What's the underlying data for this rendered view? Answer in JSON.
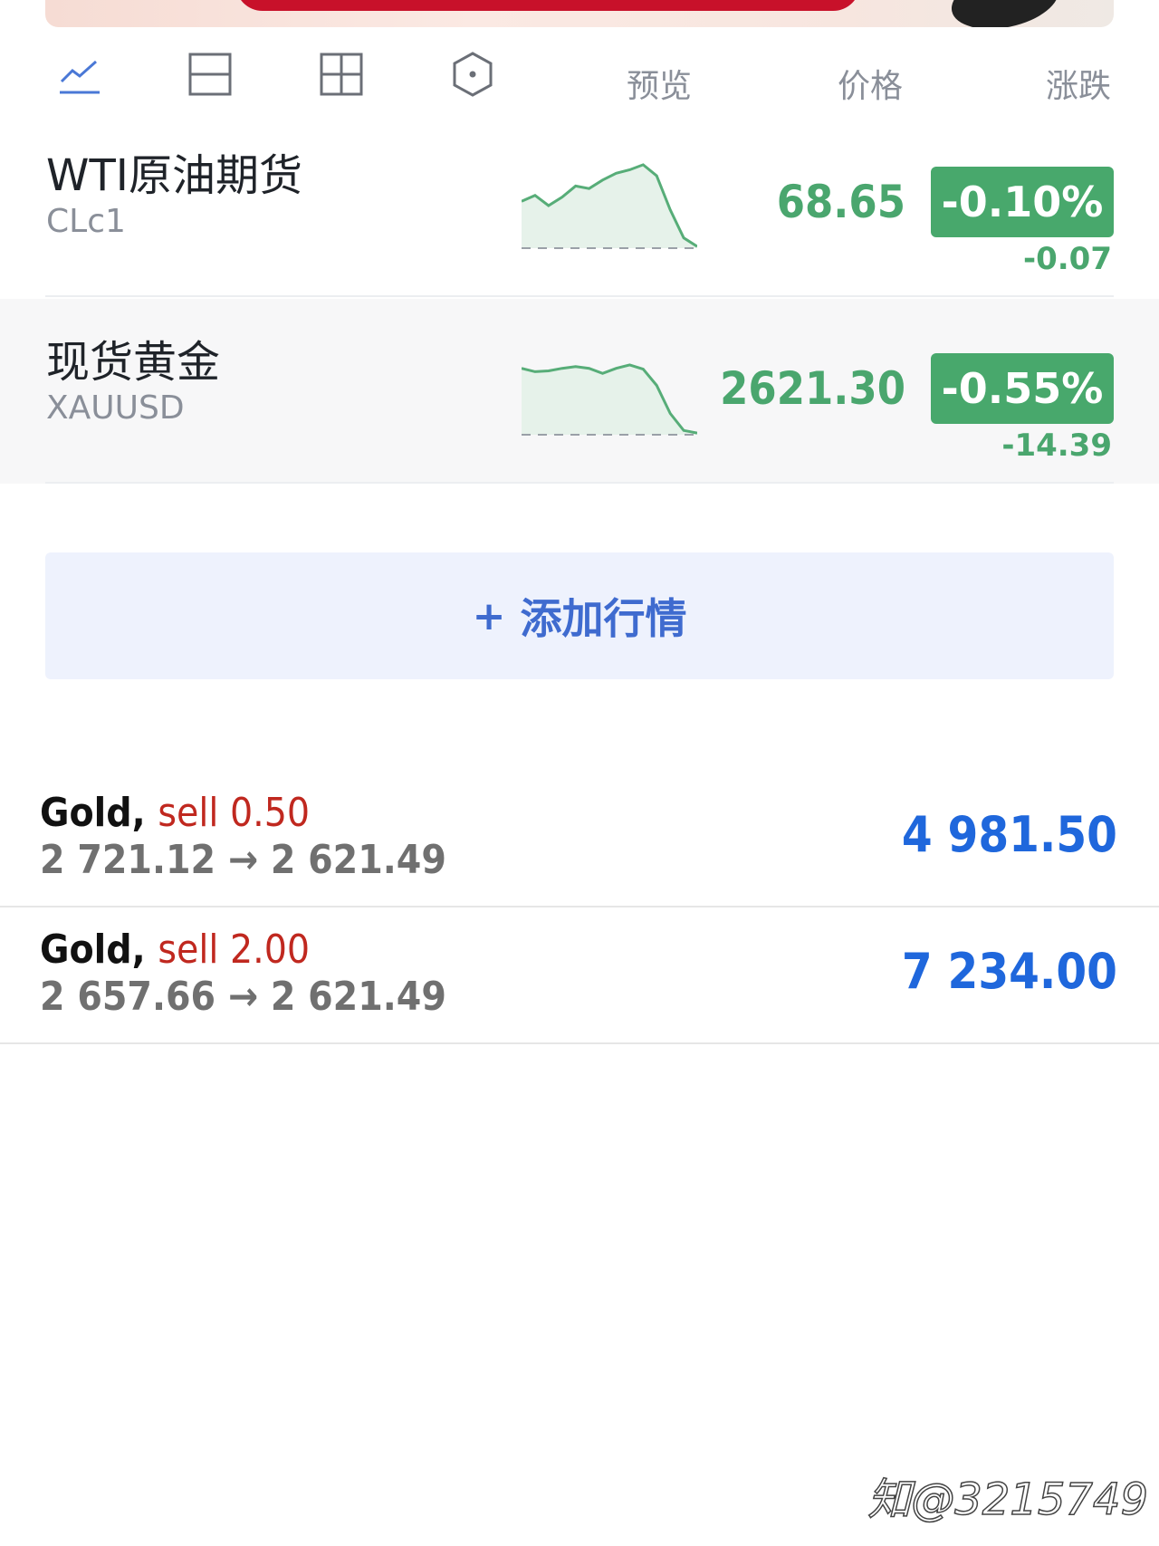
{
  "toolbar": {
    "col_preview": "预览",
    "col_price": "价格",
    "col_change": "涨跌"
  },
  "quotes": [
    {
      "name": "WTI原油期货",
      "code": "CLc1",
      "price": "68.65",
      "percent": "-0.10%",
      "change": "-0.07",
      "spark": [
        0.55,
        0.62,
        0.5,
        0.6,
        0.73,
        0.7,
        0.8,
        0.88,
        0.92,
        0.98,
        0.85,
        0.45,
        0.12,
        0.02
      ]
    },
    {
      "name": "现货黄金",
      "code": "XAUUSD",
      "price": "2621.30",
      "percent": "-0.55%",
      "change": "-14.39",
      "spark": [
        0.78,
        0.74,
        0.75,
        0.78,
        0.8,
        0.78,
        0.72,
        0.78,
        0.82,
        0.77,
        0.58,
        0.25,
        0.05,
        0.02
      ]
    }
  ],
  "add_button": {
    "plus": "+",
    "label": "添加行情"
  },
  "trades": [
    {
      "symbol": "Gold,",
      "action": "sell 0.50",
      "open": "2 721.12",
      "arrow": "→",
      "current": "2 621.49",
      "profit": "4 981.50"
    },
    {
      "symbol": "Gold,",
      "action": "sell 2.00",
      "open": "2 657.66",
      "arrow": "→",
      "current": "2 621.49",
      "profit": "7 234.00"
    }
  ],
  "watermark": "知@3215749",
  "colors": {
    "up_green": "#48a86c",
    "accent_blue": "#3f6bcf",
    "profit_blue": "#1f67dc",
    "sell_red": "#c0281f"
  }
}
